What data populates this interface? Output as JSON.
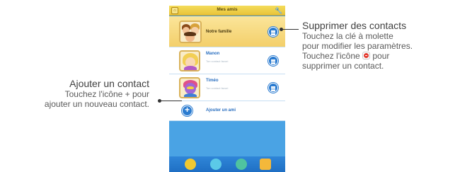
{
  "screen": {
    "title": "Mes amis",
    "home_glyph": "⌂",
    "settings_glyph": "🔧"
  },
  "contacts": [
    {
      "name": "Notre famille",
      "subtitle": ""
    },
    {
      "name": "Manon",
      "subtitle": "Ton contact favori"
    },
    {
      "name": "Timéo",
      "subtitle": "Ton contact favori"
    }
  ],
  "add_friend": {
    "label": "Ajouter un ami",
    "glyph": "+"
  },
  "tabbar": {
    "tabs": [
      "friends-tab-icon",
      "chat-tab-icon",
      "phone-tab-icon",
      "home-tab-icon"
    ],
    "colors": [
      "#f0c830",
      "#5bc9e8",
      "#4fc3a0",
      "#f4b83a"
    ]
  },
  "callouts": {
    "delete": {
      "heading": "Supprimer des contacts",
      "line1": "Touchez la clé à molette",
      "line2": "pour modifier les paramètres.",
      "line3_before": "Touchez l'icône",
      "line3_after": "pour",
      "line4": "supprimer un contact."
    },
    "add": {
      "heading": "Ajouter un contact",
      "line1": "Touchez l'icône + pour",
      "line2": "ajouter un nouveau contact."
    }
  },
  "colors": {
    "screen_bg": "#4aa3e4",
    "topbar": "#f4dc5a",
    "accent_blue": "#2a7bd0",
    "delete_red": "#e23a2e"
  }
}
